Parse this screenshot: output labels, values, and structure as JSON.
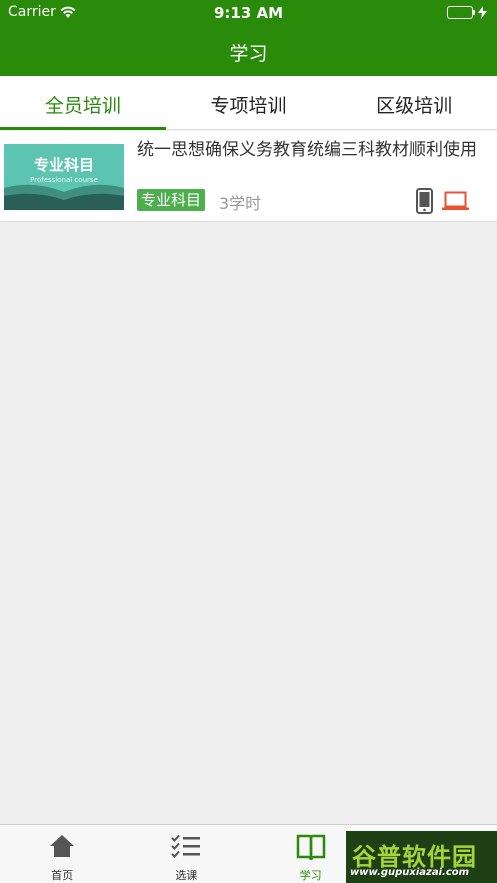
{
  "status_bar": {
    "carrier": "Carrier",
    "time": "9:13 AM"
  },
  "nav": {
    "title": "学习"
  },
  "tabs": [
    {
      "label": "全员培训",
      "active": true
    },
    {
      "label": "专项培训",
      "active": false
    },
    {
      "label": "区级培训",
      "active": false
    }
  ],
  "courses": [
    {
      "thumb_title": "专业科目",
      "thumb_subtitle": "Professional course",
      "title": "统一思想确保义务教育统编三科教材顺利使用",
      "tag": "专业科目",
      "hours": "3学时"
    }
  ],
  "tabbar": [
    {
      "label": "首页",
      "icon": "home-icon",
      "active": false
    },
    {
      "label": "选课",
      "icon": "checklist-icon",
      "active": false
    },
    {
      "label": "学习",
      "icon": "book-icon",
      "active": true
    },
    {
      "label": "",
      "icon": "user-icon",
      "active": false
    }
  ],
  "watermark": {
    "text": "谷普软件园",
    "url": "www.gupuxiazai.com"
  },
  "colors": {
    "primary": "#2a8a0a",
    "tag": "#4cae4c",
    "laptop": "#e8532f"
  }
}
